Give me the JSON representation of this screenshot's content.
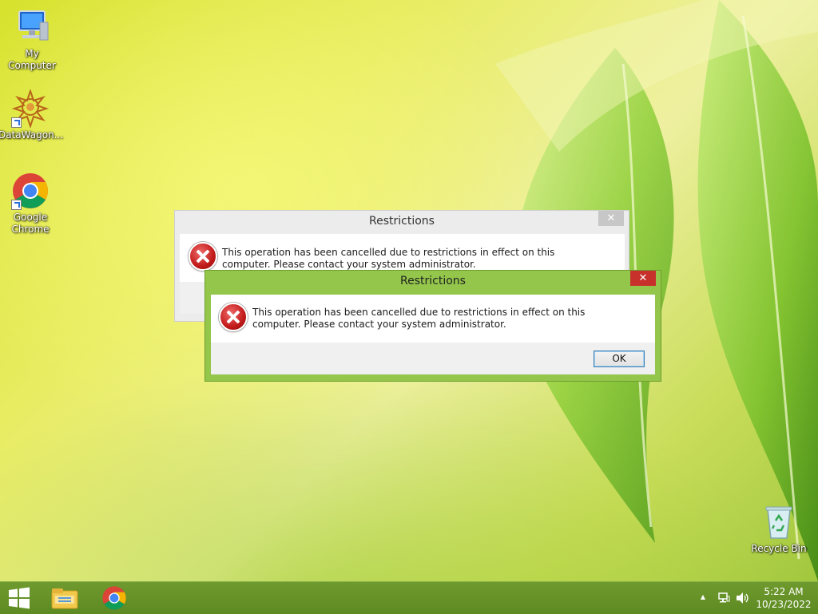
{
  "desktop": {
    "icons": [
      {
        "label": "My Computer",
        "icon": "computer-icon"
      },
      {
        "label": "DataWagon...",
        "icon": "datawagon-icon"
      },
      {
        "label": "Google Chrome",
        "icon": "chrome-icon"
      },
      {
        "label": "Recycle Bin",
        "icon": "recycle-bin-icon"
      }
    ]
  },
  "dialogs": [
    {
      "title": "Restrictions",
      "close_label": "✕",
      "message": "This operation has been cancelled due to restrictions in effect on this computer. Please contact your system administrator.",
      "icon": "error-icon",
      "state": "inactive"
    },
    {
      "title": "Restrictions",
      "close_label": "✕",
      "message": "This operation has been cancelled due to restrictions in effect on this computer. Please contact your system administrator.",
      "icon": "error-icon",
      "ok_label": "OK",
      "state": "active"
    }
  ],
  "taskbar": {
    "pinned": [
      "start-icon",
      "file-explorer-icon",
      "chrome-icon"
    ],
    "tray": {
      "time": "5:22 AM",
      "date": "10/23/2022",
      "chevron": "▲",
      "icons": [
        "network-icon",
        "volume-icon"
      ]
    }
  },
  "colors": {
    "taskbar": "#5d8a22",
    "active_frame": "#93c64b",
    "close_button": "#c7302b"
  }
}
